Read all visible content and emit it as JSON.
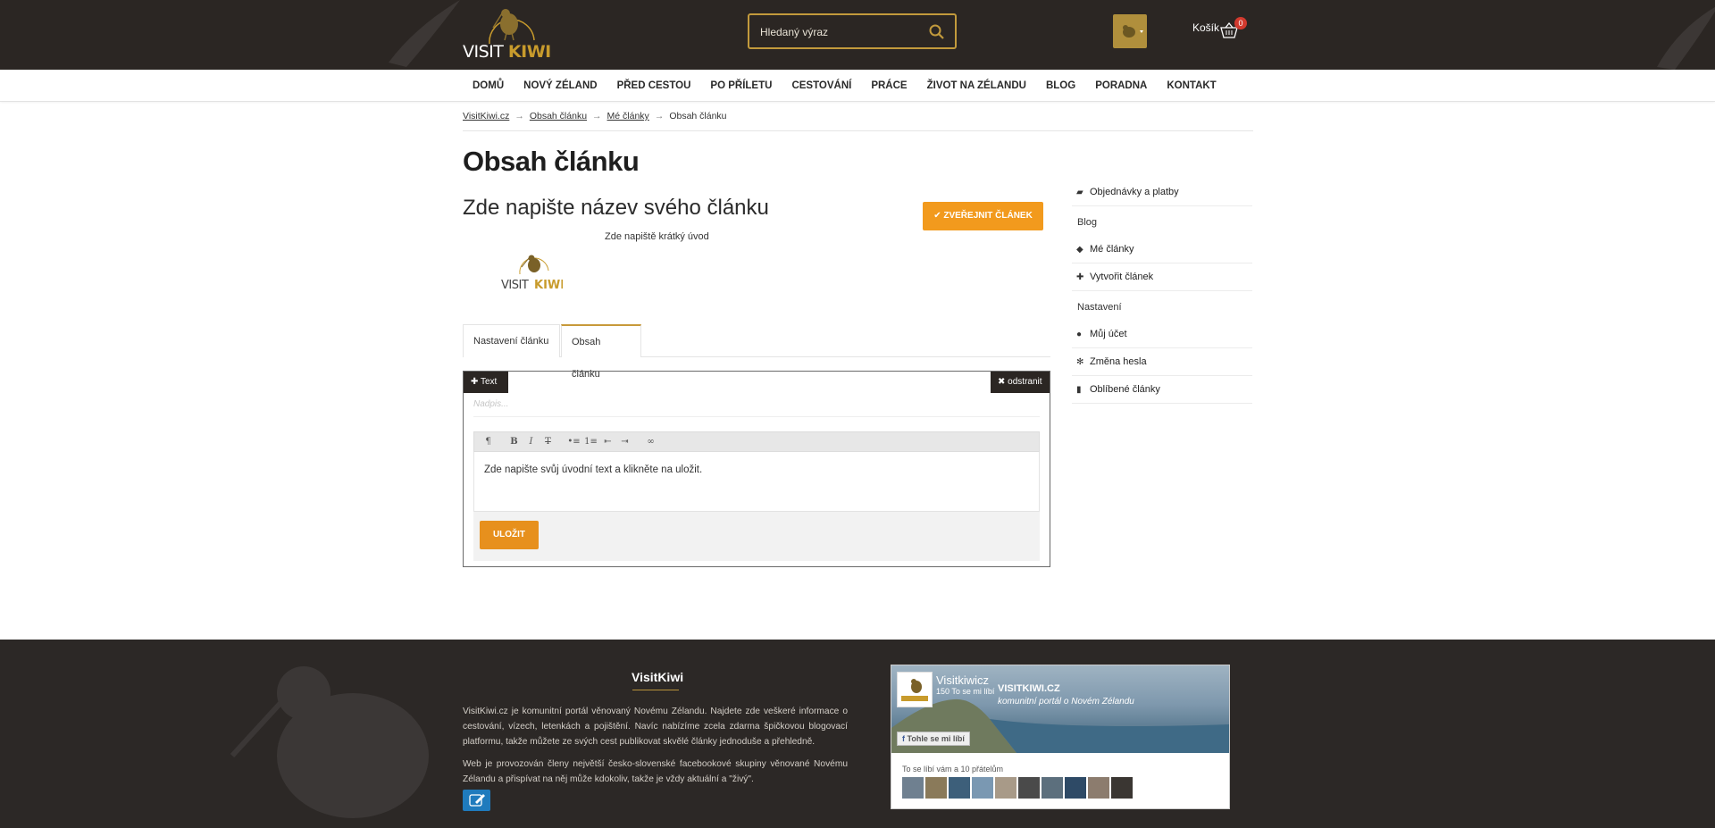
{
  "header": {
    "logo": {
      "word1": "VISIT",
      "word2": "KIWI"
    },
    "search": {
      "placeholder": "Hledaný výraz"
    },
    "cart": {
      "label": "Košík",
      "count": "0"
    }
  },
  "nav": {
    "items": [
      "DOMŮ",
      "NOVÝ ZÉLAND",
      "PŘED CESTOU",
      "PO PŘÍLETU",
      "CESTOVÁNÍ",
      "PRÁCE",
      "ŽIVOT NA ZÉLANDU",
      "BLOG",
      "PORADNA",
      "KONTAKT"
    ]
  },
  "breadcrumb": {
    "items": [
      "VisitKiwi.cz",
      "Obsah článku",
      "Mé články",
      "Obsah článku"
    ],
    "separator": "→"
  },
  "page": {
    "title": "Obsah článku",
    "article_title": "Zde napište název svého článku",
    "article_intro": "Zde napiště krátký úvod",
    "publish_label": "ZVEŘEJNIT ČLÁNEK"
  },
  "tabs": [
    {
      "label": "Nastavení článku",
      "active": false
    },
    {
      "label": "Obsah článku",
      "active": true
    }
  ],
  "editor": {
    "block_type_label": "Text",
    "remove_label": "odstranit",
    "heading_placeholder": "Nadpis...",
    "toolbar": [
      "¶",
      "B",
      "I",
      "T",
      "•≡",
      "1≡",
      "⇤",
      "⇥",
      "∞"
    ],
    "body_text": "Zde napište svůj úvodní text a klikněte na uložit.",
    "save_label": "ULOŽIT"
  },
  "sidebar": {
    "items_top": [
      {
        "icon": "briefcase-icon",
        "label": "Objednávky a platby"
      }
    ],
    "blog_heading": "Blog",
    "blog_items": [
      {
        "icon": "tags-icon",
        "label": "Mé články"
      },
      {
        "icon": "plus-icon",
        "label": "Vytvořit článek"
      }
    ],
    "settings_heading": "Nastavení",
    "settings_items": [
      {
        "icon": "user-icon",
        "label": "Můj účet"
      },
      {
        "icon": "gear-icon",
        "label": "Změna hesla"
      },
      {
        "icon": "bookmark-icon",
        "label": "Oblíbené články"
      }
    ]
  },
  "footer": {
    "title": "VisitKiwi",
    "p1": "VisitKiwi.cz je komunitní portál věnovaný Novému Zélandu. Najdete zde veškeré informace o cestování, vízech, letenkách a pojištění. Navíc nabízíme zcela zdarma špičkovou blogovací platformu, takže můžete ze svých cest publikovat skvělé články jednoduše a přehledně.",
    "p2": "Web je provozován členy největší česko-slovenské facebookové skupiny věnované Novému Zélandu a přispívat na něj může kdokoliv, takže je vždy aktuální a \"živý\".",
    "facebook": {
      "page_name": "Visitkiwicz",
      "likes": "150 To se mi líbí",
      "brand": "VISITKIWI.CZ",
      "tagline": "komunitní portál o Novém Zélandu",
      "like_button": "Tohle se mi líbí",
      "friends_text": "To se líbí vám a 10 přátelům"
    }
  },
  "colors": {
    "dark": "#2b2623",
    "gold": "#c89b2c",
    "orange": "#f29a1d"
  }
}
